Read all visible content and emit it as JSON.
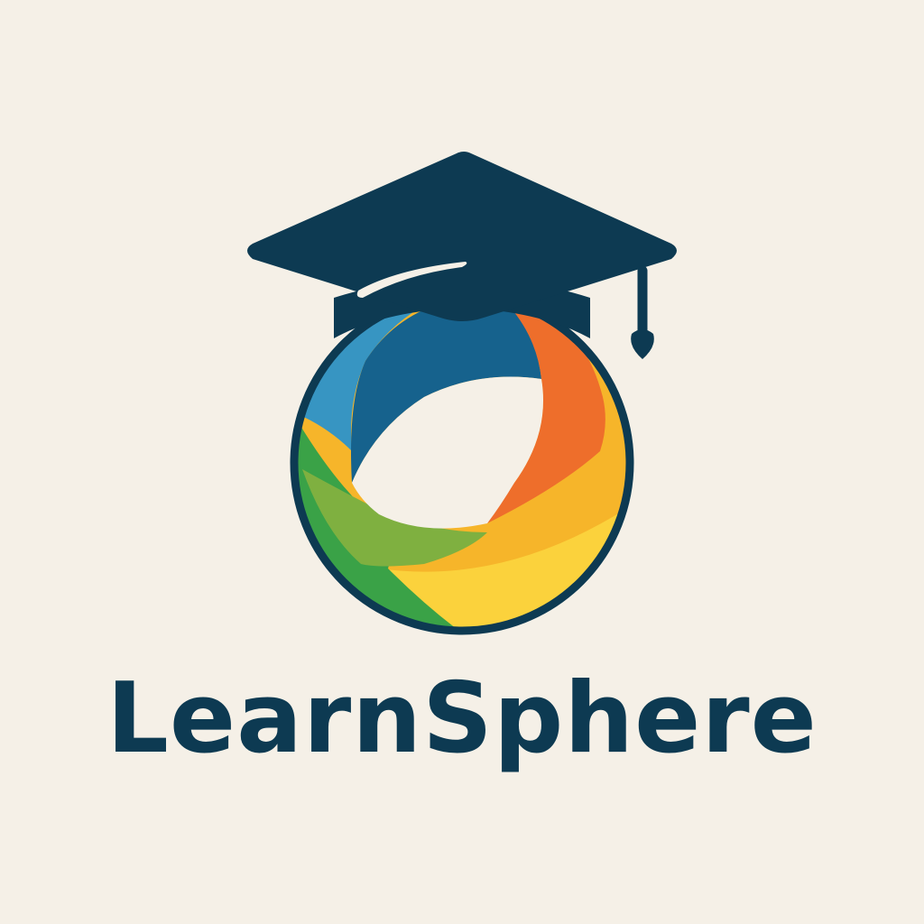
{
  "brand": {
    "name": "LearnSphere"
  },
  "colors": {
    "background": "#f5f0e7",
    "navy": "#0d3a52",
    "blue_light": "#3795c2",
    "blue_dark": "#16628d",
    "orange": "#ee6e2b",
    "yellow": "#f6b52a",
    "yellow_light": "#fbd23c",
    "green": "#3aa247",
    "green_light": "#7fb040"
  },
  "icons": {
    "cap": "graduation-cap-icon",
    "globe": "color-swirl-globe-icon"
  }
}
